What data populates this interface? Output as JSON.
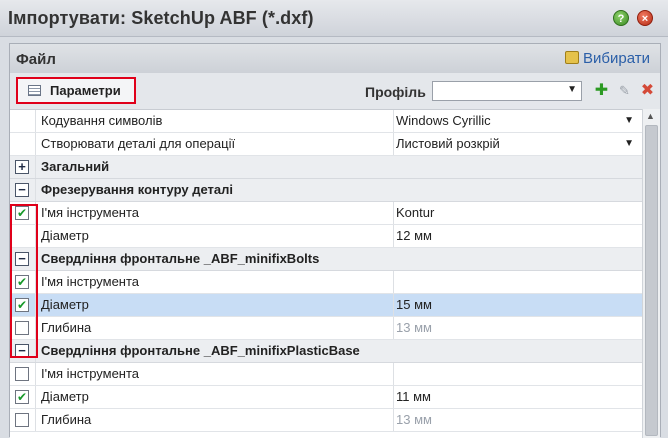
{
  "window": {
    "title": "Імпортувати: SketchUp ABF (*.dxf)"
  },
  "header": {
    "title": "Файл",
    "choose_label": "Вибирати"
  },
  "toolbar": {
    "params_label": "Параметри",
    "profile_label": "Профіль",
    "profile_value": ""
  },
  "rows": [
    {
      "type": "item",
      "name": "Кодування символів",
      "value": "Windows Cyrillic",
      "dropdown": true
    },
    {
      "type": "item",
      "name": "Створювати деталі для операції",
      "value": "Листовий розкрій",
      "dropdown": true
    },
    {
      "type": "group",
      "name": "Загальний",
      "expanded": false
    },
    {
      "type": "group",
      "name": "Фрезерування контуру деталі",
      "expanded": true
    },
    {
      "type": "item",
      "checked": true,
      "name": "І'мя інструмента",
      "value": "Kontur"
    },
    {
      "type": "item",
      "name": "Діаметр",
      "value": "12 мм"
    },
    {
      "type": "group",
      "name": "Свердління фронтальне _ABF_minifixBolts",
      "expanded": true
    },
    {
      "type": "item",
      "checked": true,
      "name": "І'мя інструмента",
      "value": ""
    },
    {
      "type": "item",
      "checked": true,
      "selected": true,
      "name": "Діаметр",
      "value": "15 мм"
    },
    {
      "type": "item",
      "checked": false,
      "name": "Глибина",
      "value": "13 мм",
      "muted": true
    },
    {
      "type": "group",
      "name": "Свердління фронтальне _ABF_minifixPlasticBase",
      "expanded": true
    },
    {
      "type": "item",
      "checked": false,
      "name": "І'мя інструмента",
      "value": ""
    },
    {
      "type": "item",
      "checked": true,
      "name": "Діаметр",
      "value": "11 мм"
    },
    {
      "type": "item",
      "checked": false,
      "name": "Глибина",
      "value": "13 мм",
      "muted": true
    }
  ],
  "colors": {
    "highlight": "#e0001a",
    "selection": "#c8ddf5",
    "link": "#2b5fa8"
  }
}
